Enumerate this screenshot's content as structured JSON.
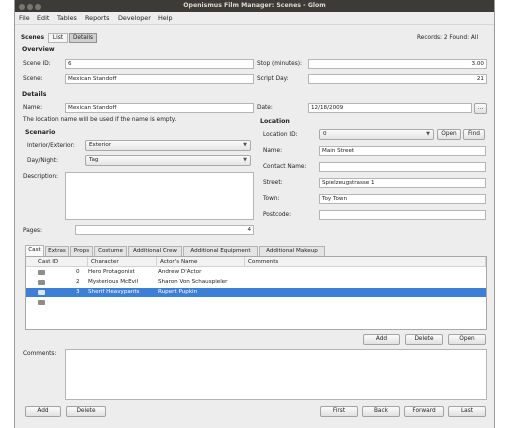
{
  "window": {
    "title": "Openismus Film Manager: Scenes - Glom"
  },
  "menu": [
    "File",
    "Edit",
    "Tables",
    "Reports",
    "Developer",
    "Help"
  ],
  "toolbar": {
    "table_label": "Scenes",
    "list_label": "List",
    "details_label": "Details",
    "records": "Records: 2 Found: All"
  },
  "overview": {
    "heading": "Overview",
    "scene_id_label": "Scene ID:",
    "scene_id": "6",
    "scene_label": "Scene:",
    "scene": "Mexican Standoff",
    "stop_label": "Stop (minutes):",
    "stop": "3.00",
    "script_day_label": "Script Day:",
    "script_day": "21"
  },
  "details": {
    "heading": "Details",
    "name_label": "Name:",
    "name": "Mexican Standoff",
    "date_label": "Date:",
    "date": "12/18/2009",
    "date_btn": "...",
    "hint": "The location name will be used if the name is empty."
  },
  "scenario": {
    "heading": "Scenario",
    "int_ext_label": "Interior/Exterior:",
    "int_ext": "Exterior",
    "day_night_label": "Day/Night:",
    "day_night": "Tag",
    "description_label": "Description:",
    "pages_label": "Pages:",
    "pages": "4"
  },
  "location": {
    "heading": "Location",
    "id_label": "Location ID:",
    "id": "0",
    "open_btn": "Open",
    "find_btn": "Find",
    "name_label": "Name:",
    "name": "Main Street",
    "contact_label": "Contact Name:",
    "contact": "",
    "street_label": "Street:",
    "street": "Spielzeugstrasse 1",
    "town_label": "Town:",
    "town": "Toy Town",
    "postcode_label": "Postcode:",
    "postcode": ""
  },
  "tabs": [
    "Cast",
    "Extras",
    "Props",
    "Costume",
    "Additional Crew",
    "Additional Equipment",
    "Additional Makeup"
  ],
  "cast_table": {
    "headers": [
      "Cast ID",
      "Character",
      "Actor's Name",
      "Comments"
    ],
    "rows": [
      {
        "id": "0",
        "character": "Hero Protagonist",
        "actor": "Andrew D'Actor",
        "comments": ""
      },
      {
        "id": "2",
        "character": "Mysterious McEvil",
        "actor": "Sharon Von Schauspieler",
        "comments": ""
      },
      {
        "id": "3",
        "character": "Sherif Heavypants",
        "actor": "Rupert Pupkin",
        "comments": ""
      },
      {
        "id": "",
        "character": "",
        "actor": "",
        "comments": ""
      }
    ],
    "add_btn": "Add",
    "delete_btn": "Delete",
    "open_btn": "Open"
  },
  "comments_label": "Comments:",
  "nav": {
    "add": "Add",
    "delete": "Delete",
    "first": "First",
    "back": "Back",
    "forward": "Forward",
    "last": "Last"
  },
  "colors": {
    "selection": "#3d7fd6",
    "titlebar": "#3c3b37"
  }
}
